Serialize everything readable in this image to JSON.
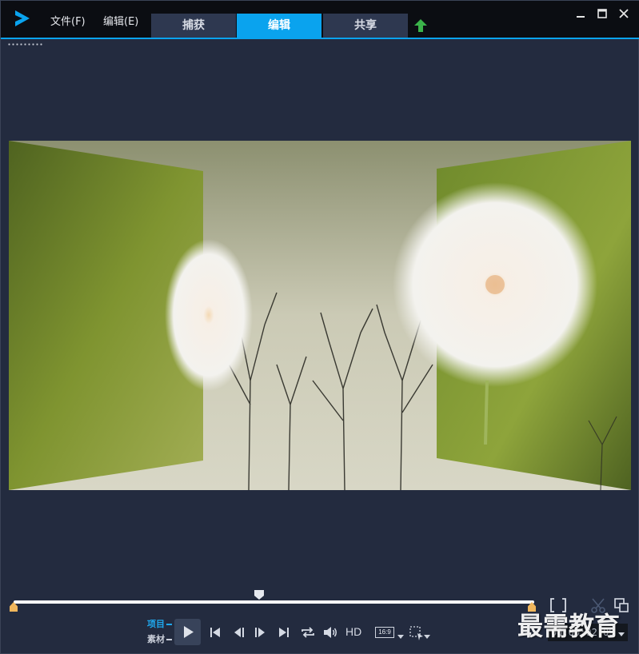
{
  "menu": {
    "file": "文件(F)",
    "edit": "编辑(E)"
  },
  "tabs": [
    {
      "label": "捕获",
      "active": false
    },
    {
      "label": "编辑",
      "active": true
    },
    {
      "label": "共享",
      "active": false
    }
  ],
  "window_controls": {
    "minimize": "—",
    "maximize": "□",
    "close": "✕"
  },
  "colors": {
    "accent": "#0aa3ee",
    "background": "#232b3f",
    "titlebar": "#0b0d12",
    "trim_marker": "#f0b65c",
    "upload": "#3bb34a"
  },
  "playback": {
    "mode_project": "项目",
    "mode_clip": "素材",
    "hd_label": "HD",
    "aspect_ratio": "16:9",
    "timecode": "00:00:02:09"
  },
  "watermark": "最需教育",
  "icons": [
    "app-logo-icon",
    "upload-icon",
    "minimize-icon",
    "maximize-icon",
    "close-icon",
    "play-icon",
    "go-to-start-icon",
    "previous-frame-icon",
    "next-frame-icon",
    "go-to-end-icon",
    "repeat-icon",
    "volume-icon",
    "crop-select-icon",
    "mark-in-out-icon",
    "split-scissors-icon",
    "enlarge-preview-icon"
  ]
}
